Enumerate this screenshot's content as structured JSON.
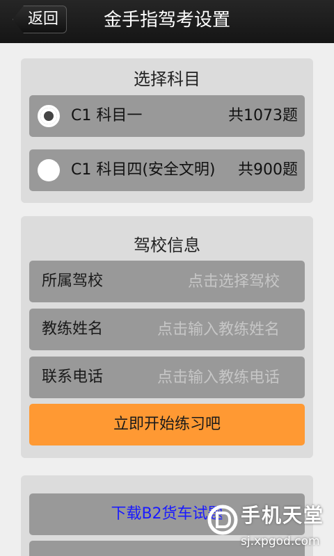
{
  "header": {
    "back_label": "返回",
    "title": "金手指驾考设置"
  },
  "subject_section": {
    "title": "选择科目",
    "options": [
      {
        "label": "C1 科目一",
        "count": "共1073题",
        "selected": true
      },
      {
        "label": "C1 科目四(安全文明)",
        "count": "共900题",
        "selected": false
      }
    ]
  },
  "school_section": {
    "title": "驾校信息",
    "fields": [
      {
        "label": "所属驾校",
        "value": "",
        "placeholder": "点击选择驾校"
      },
      {
        "label": "教练姓名",
        "value": "",
        "placeholder": "点击输入教练姓名"
      },
      {
        "label": "联系电话",
        "value": "",
        "placeholder": "点击输入教练电话"
      }
    ],
    "start_button": "立即开始练习吧"
  },
  "download_section": {
    "download_label": "下载B2货车试题"
  },
  "watermark": {
    "text": "手机天堂",
    "url": "sj.xpgod.com"
  },
  "colors": {
    "header_bg": "#1c1c1c",
    "panel_bg": "#dcdcdc",
    "row_bg": "#999999",
    "accent_orange": "#ff9933",
    "link_blue": "#1a1aff"
  }
}
